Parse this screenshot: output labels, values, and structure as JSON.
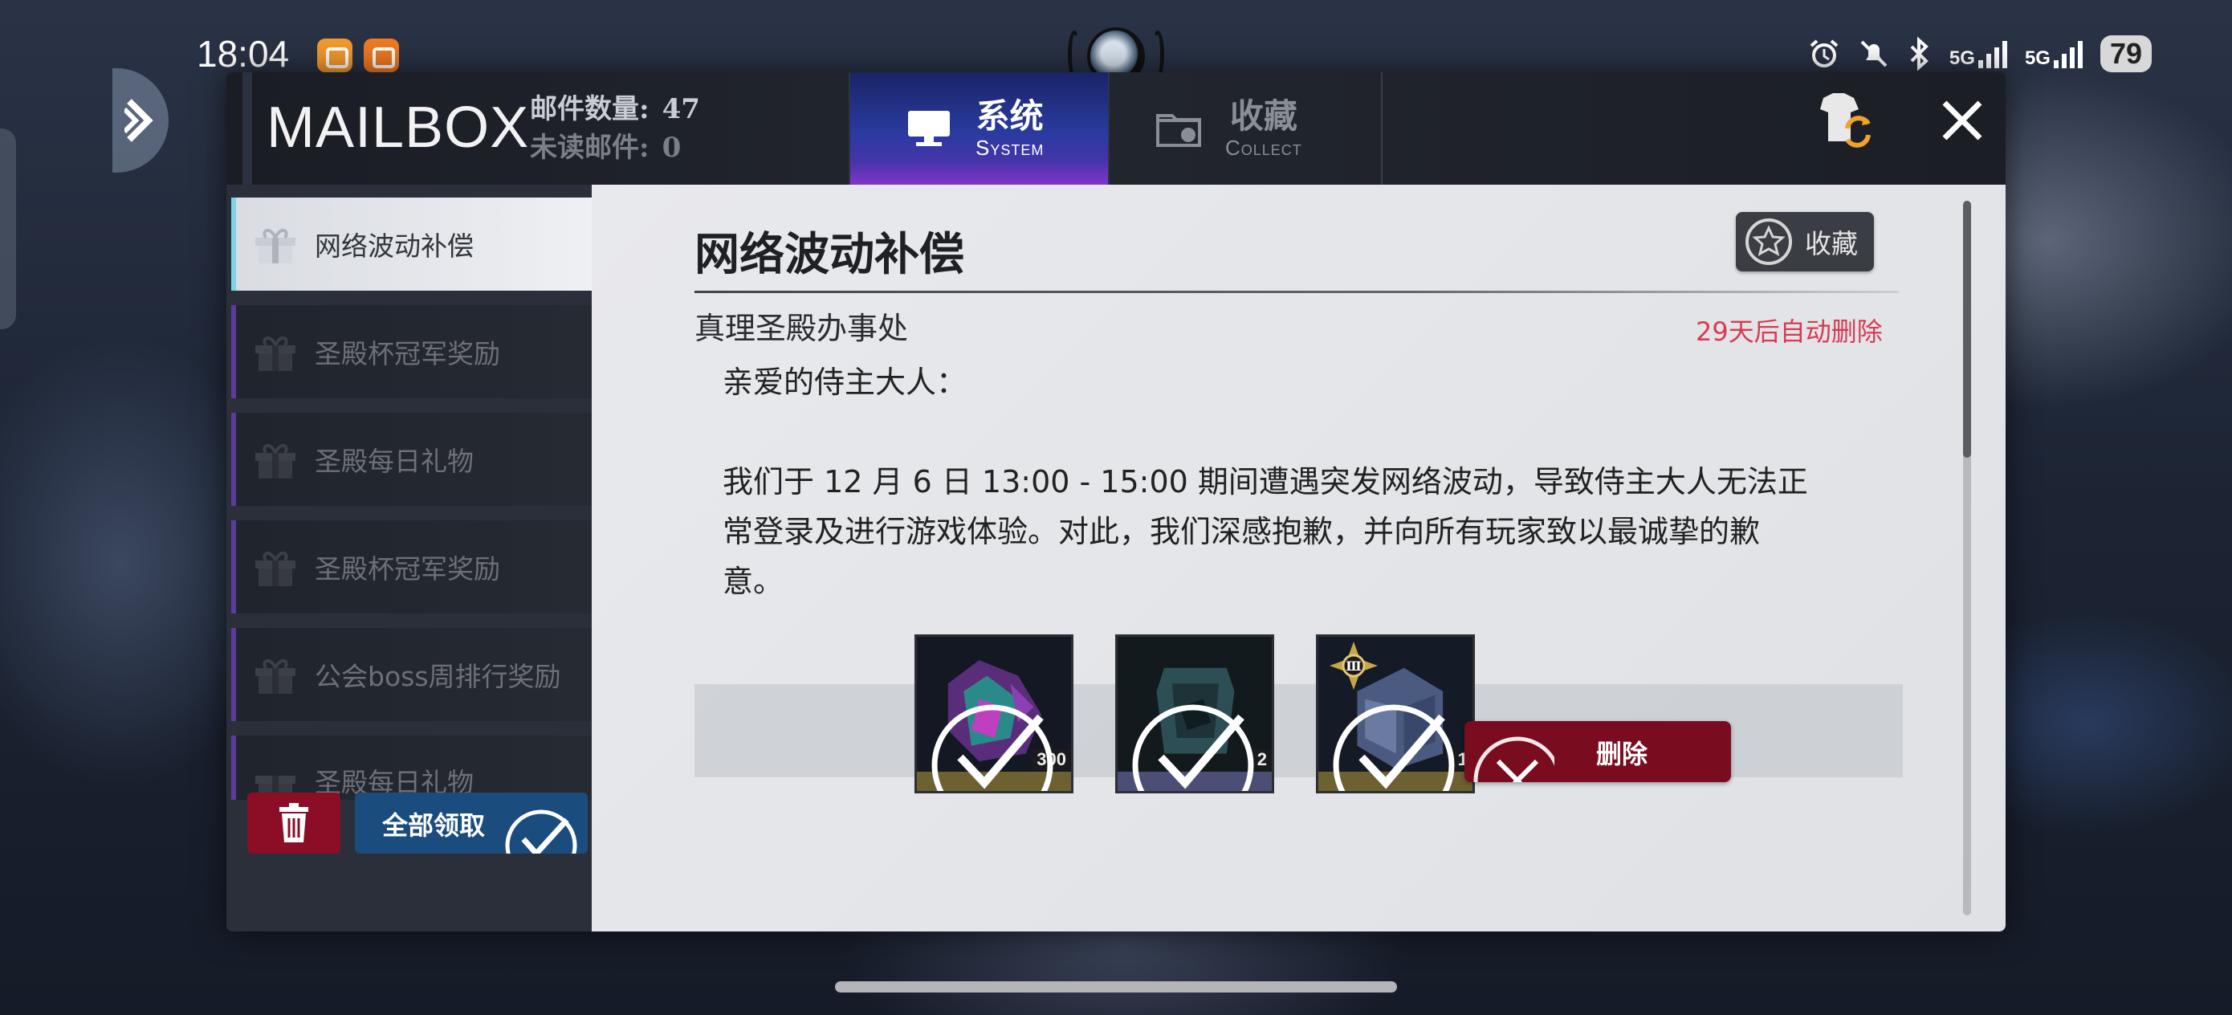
{
  "status_bar": {
    "time": "18:04",
    "battery": "79",
    "signal_1": "5G",
    "signal_2": "5G"
  },
  "header": {
    "title": "MAILBOX",
    "mail_count_label": "邮件数量:",
    "mail_count_value": "47",
    "unread_label": "未读邮件:",
    "unread_value": "0"
  },
  "tabs": [
    {
      "cn": "系统",
      "en": "System",
      "active": true
    },
    {
      "cn": "收藏",
      "en": "Collect",
      "active": false
    }
  ],
  "mail_list": [
    {
      "title": "网络波动补偿",
      "selected": true
    },
    {
      "title": "圣殿杯冠军奖励",
      "selected": false
    },
    {
      "title": "圣殿每日礼物",
      "selected": false
    },
    {
      "title": "圣殿杯冠军奖励",
      "selected": false
    },
    {
      "title": "公会boss周排行奖励",
      "selected": false
    },
    {
      "title": "圣殿每日礼物",
      "selected": false
    }
  ],
  "sidebar_actions": {
    "claim_all": "全部领取"
  },
  "mail": {
    "title": "网络波动补偿",
    "favorite": "收藏",
    "sender": "真理圣殿办事处",
    "expire": "29天后自动删除",
    "greeting": "亲爱的侍主大人：",
    "body_line1": "我们于 12 月 6 日 13:00 - 15:00 期间遭遇突发网络波动，导致侍主大人无法正",
    "body_line2": "常登录及进行游戏体验。对此，我们深感抱歉，并向所有玩家致以最诚挚的歉",
    "body_line3": "意。",
    "delete": "删除"
  },
  "rewards": [
    {
      "qty": "300",
      "claimed": true
    },
    {
      "qty": "2",
      "claimed": true
    },
    {
      "qty": "1",
      "claimed": true,
      "badge": "Ⅲ"
    }
  ],
  "colors": {
    "expire_text": "#d83a52",
    "delete_button": "#7a0c1f",
    "trash_button": "#8b0e26",
    "claim_button": "#1a4c7e",
    "system_tab": "#2a3ba0"
  }
}
